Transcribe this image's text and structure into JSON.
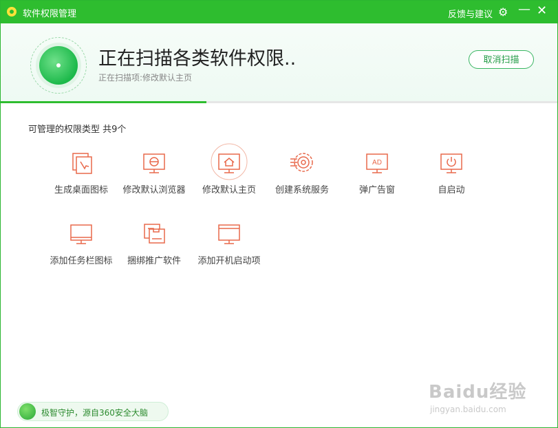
{
  "window": {
    "title": "软件权限管理",
    "feedback_label": "反馈与建议"
  },
  "scan": {
    "headline": "正在扫描各类软件权限..",
    "subline": "正在扫描项:修改默认主页",
    "cancel_label": "取消扫描",
    "progress": 0.37
  },
  "section": {
    "title": "可管理的权限类型 共9个"
  },
  "permissions": [
    {
      "label": "生成桌面图标",
      "icon": "desktop-shortcut-icon"
    },
    {
      "label": "修改默认浏览器",
      "icon": "browser-icon"
    },
    {
      "label": "修改默认主页",
      "icon": "homepage-icon",
      "active": true
    },
    {
      "label": "创建系统服务",
      "icon": "system-service-icon"
    },
    {
      "label": "弹广告窗",
      "icon": "ad-popup-icon"
    },
    {
      "label": "自启动",
      "icon": "autostart-icon"
    },
    {
      "label": "添加任务栏图标",
      "icon": "taskbar-icon"
    },
    {
      "label": "捆绑推广软件",
      "icon": "bundle-software-icon"
    },
    {
      "label": "添加开机启动项",
      "icon": "startup-item-icon"
    }
  ],
  "footer": {
    "text": "极智守护，源自360安全大脑"
  },
  "watermark": {
    "main": "Baidu经验",
    "sub": "jingyan.baidu.com"
  },
  "colors": {
    "brand_green": "#2ebd2f",
    "icon_orange": "#e8684a"
  }
}
